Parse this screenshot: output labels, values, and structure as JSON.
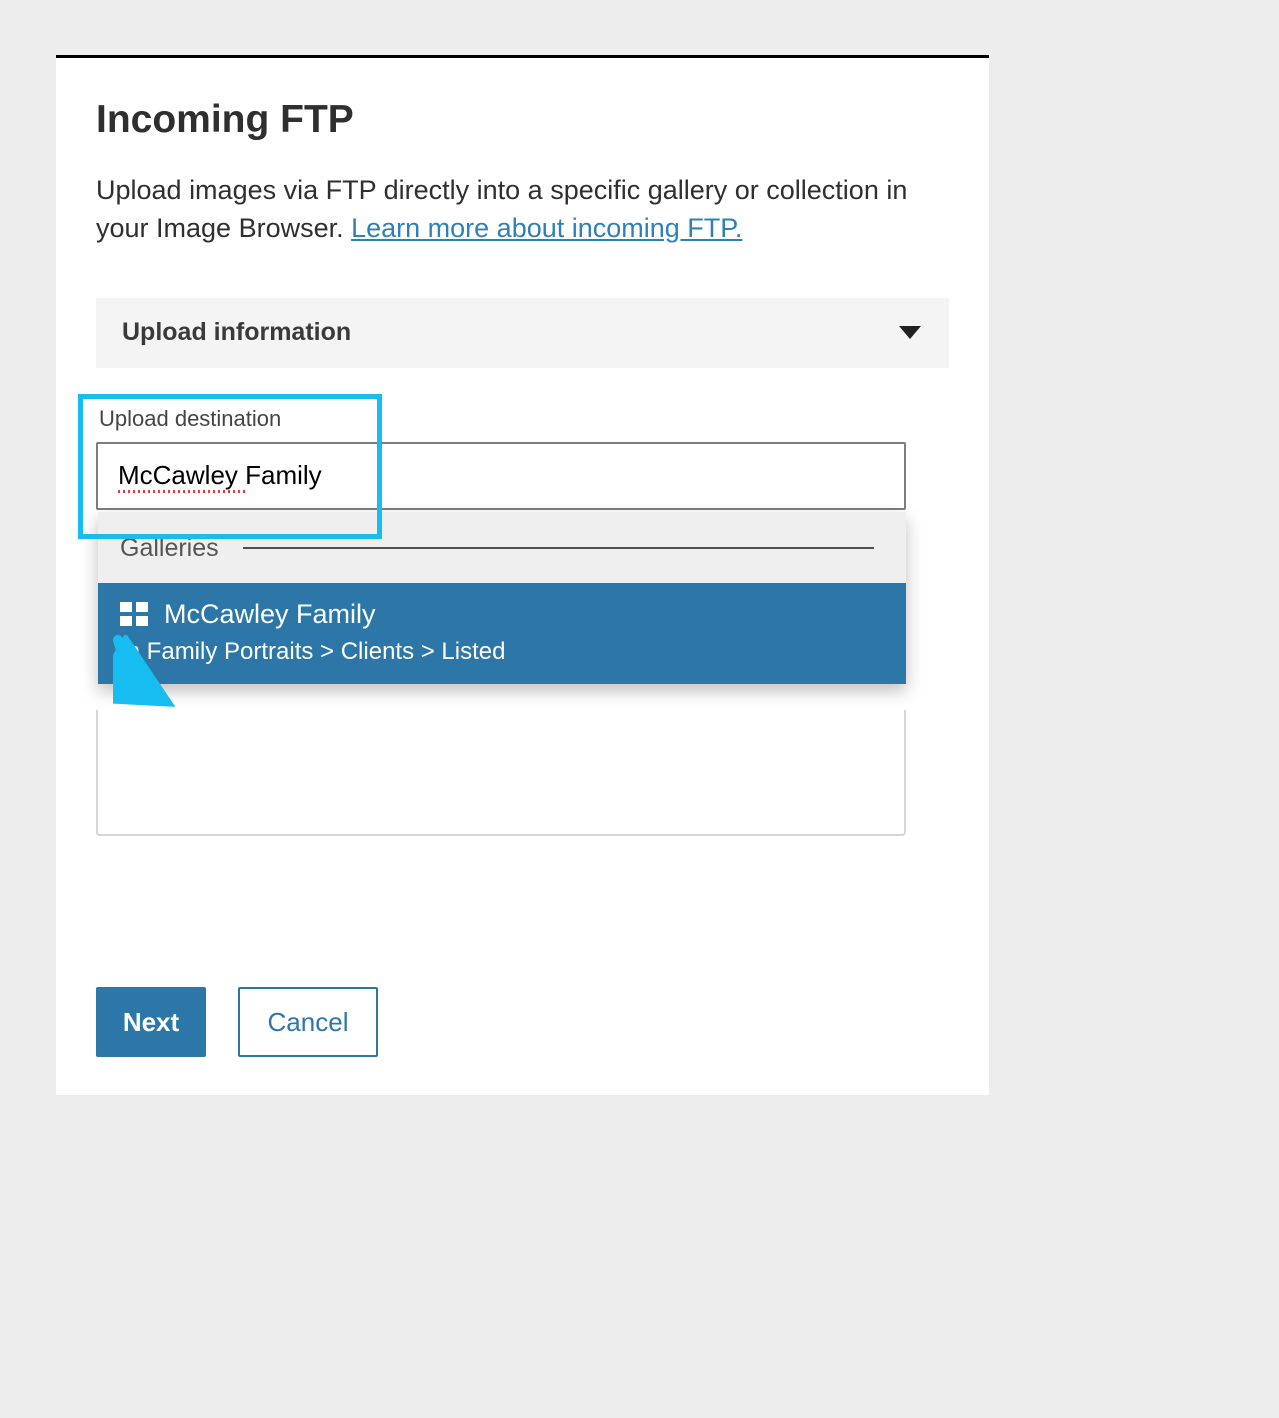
{
  "page": {
    "title": "Incoming FTP",
    "description_prefix": "Upload images via FTP directly into a specific gallery or collection in your Image Browser. ",
    "learn_more_text": "Learn more about incoming FTP."
  },
  "accordion": {
    "title": "Upload information"
  },
  "destination": {
    "label": "Upload destination",
    "value": "McCawley Family"
  },
  "dropdown": {
    "section_label": "Galleries",
    "item": {
      "title": "McCawley Family",
      "path": "In Family Portraits > Clients > Listed"
    }
  },
  "buttons": {
    "next": "Next",
    "cancel": "Cancel"
  }
}
